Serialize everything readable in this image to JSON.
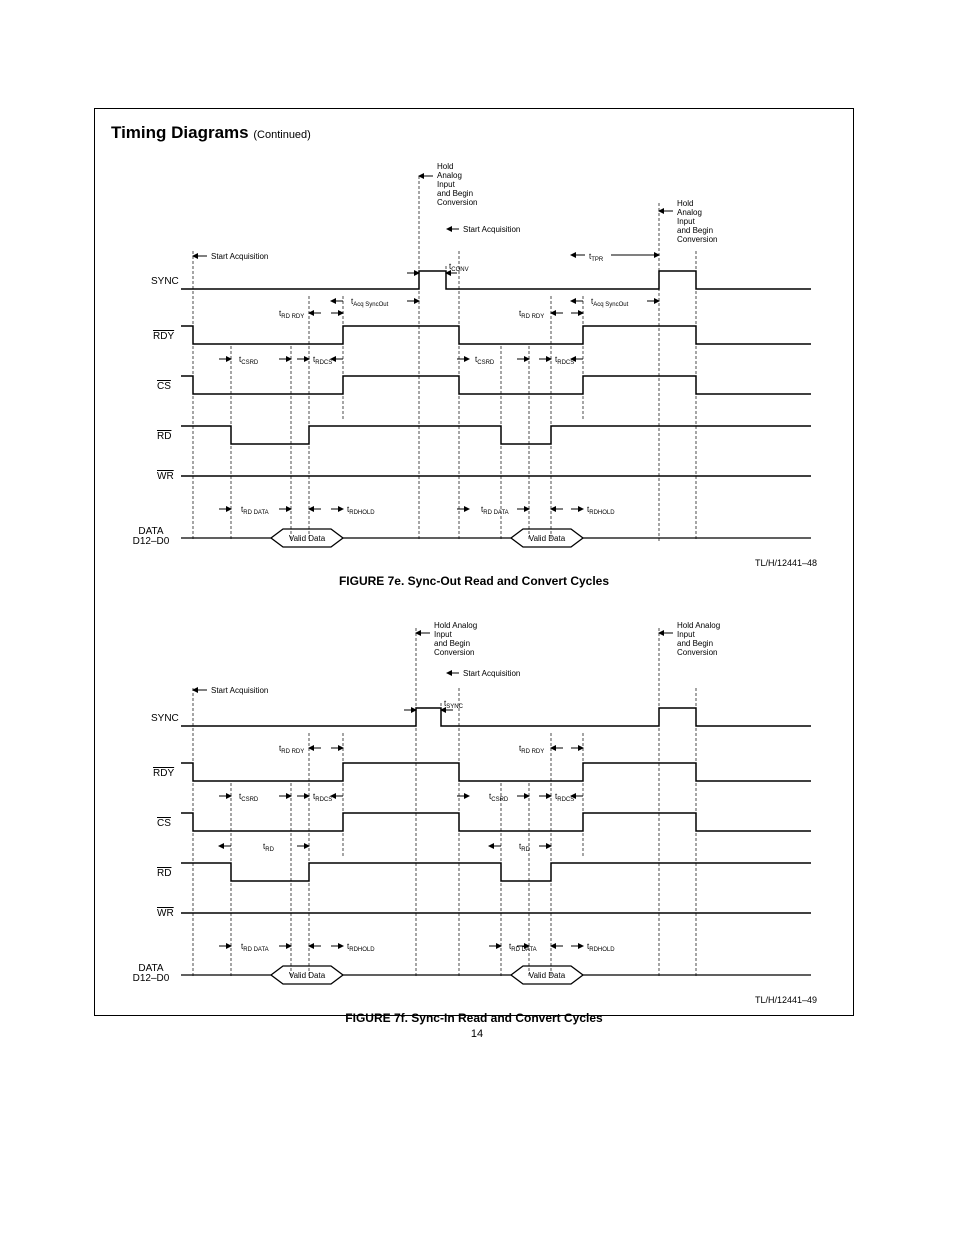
{
  "header": {
    "title": "Timing Diagrams",
    "continued": "(Continued)"
  },
  "pageNumber": "14",
  "diagram1": {
    "caption": "FIGURE 7e. Sync-Out Read and Convert Cycles",
    "tlref": "TL/H/12441–48",
    "signals": {
      "sync": "SYNC",
      "rdy": "RDY",
      "cs": "CS",
      "rd": "RD",
      "wr": "WR",
      "data": "DATA",
      "data2": "D12–D0"
    },
    "annotations": {
      "holdAnalog": "Hold\nAnalog\nInput\nand Begin\nConversion",
      "holdAnalog2": "Hold\nAnalog\nInput\nand Begin\nConversion",
      "startAcq": "Start Acquisition",
      "startAcq2": "Start Acquisition",
      "tTPR": "tTPR",
      "tCONV": "tCONV",
      "tAcqSyncOut": "tAcq SyncOut",
      "tRDRDY": "tRD RDY",
      "tCSRD": "tCSRD",
      "tRDCS": "tRDCS",
      "tRDDATA": "tRD DATA",
      "tRDHOLD": "tRDHOLD",
      "validData": "Valid Data"
    }
  },
  "diagram2": {
    "caption": "FIGURE 7f. Sync-In Read and Convert Cycles",
    "tlref": "TL/H/12441–49",
    "signals": {
      "sync": "SYNC",
      "rdy": "RDY",
      "cs": "CS",
      "rd": "RD",
      "wr": "WR",
      "data": "DATA",
      "data2": "D12–D0"
    },
    "annotations": {
      "holdAnalog": "Hold Analog\nInput\nand Begin\nConversion",
      "holdAnalog2": "Hold Analog\nInput\nand Begin\nConversion",
      "startAcq": "Start Acquisition",
      "startAcq2": "Start Acquisition",
      "tSYNC": "tSYNC",
      "tRDRDY": "tRD RDY",
      "tCSRD": "tCSRD",
      "tRDCS": "tRDCS",
      "tRD": "tRD",
      "tRDDATA": "tRD DATA",
      "tRDHOLD": "tRDHOLD",
      "validData": "Valid Data"
    }
  }
}
